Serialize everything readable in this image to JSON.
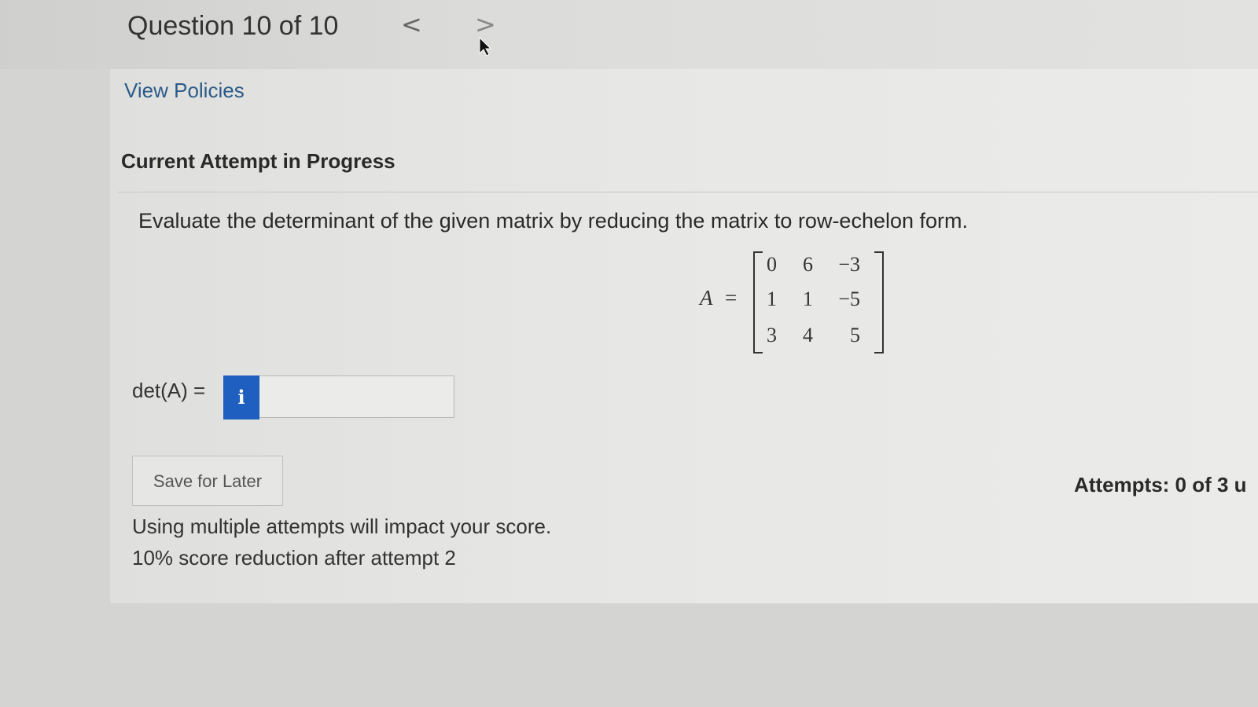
{
  "header": {
    "question_counter": "Question 10 of 10",
    "prev_icon": "chevron-left-icon",
    "prev_glyph": "<",
    "next_icon": "chevron-right-icon",
    "next_glyph": ">"
  },
  "links": {
    "view_policies": "View Policies"
  },
  "attempt": {
    "heading": "Current Attempt in Progress"
  },
  "question": {
    "prompt": "Evaluate the determinant of the given matrix by reducing the matrix to row-echelon form.",
    "matrix_name": "A",
    "equals": "=",
    "matrix": [
      [
        "0",
        "6",
        "−3"
      ],
      [
        "1",
        "1",
        "−5"
      ],
      [
        "3",
        "4",
        "5"
      ]
    ]
  },
  "answer": {
    "label": "det(A) =",
    "info_glyph": "i",
    "value": "",
    "placeholder": ""
  },
  "actions": {
    "save_label": "Save for Later"
  },
  "attempts": {
    "text": "Attempts: 0 of 3 u"
  },
  "notices": {
    "line1": "Using multiple attempts will impact your score.",
    "line2": "10% score reduction after attempt 2"
  },
  "colors": {
    "info_button": "#1f5fbf",
    "link": "#2b5b8a"
  }
}
